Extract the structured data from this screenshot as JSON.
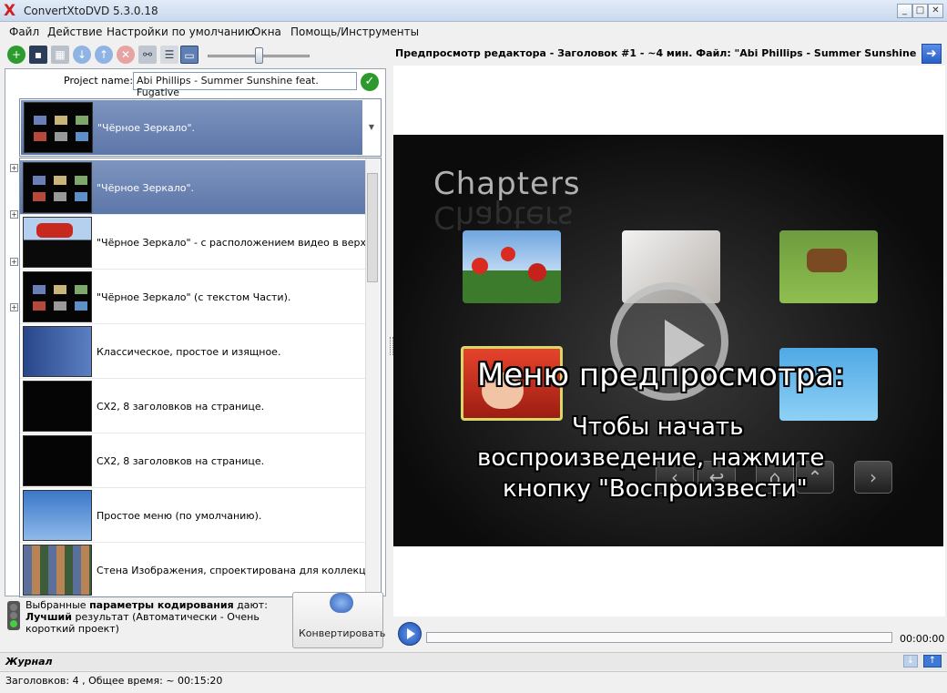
{
  "window": {
    "title": "ConvertXtoDVD 5.3.0.18",
    "app_icon": "X",
    "minimize": "_",
    "maximize": "□",
    "close": "✕"
  },
  "menu": [
    "Файл",
    "Действие",
    "Настройки по умолчанию",
    "Окна",
    "Помощь/Инструменты"
  ],
  "toolbar_icons": [
    "add-icon",
    "save-icon",
    "split-icon",
    "down-icon",
    "up-icon",
    "remove-icon",
    "link-icon",
    "list-icon",
    "monitor-icon"
  ],
  "project": {
    "label": "Project name:",
    "value": "Abi Phillips - Summer Sunshine feat. Fugative"
  },
  "menu_template": {
    "selected": "\"Чёрное Зеркало\".",
    "options": [
      "\"Чёрное Зеркало\".",
      "\"Чёрное Зеркало\" - с расположением видео в верхней трети",
      "\"Чёрное Зеркало\" (с текстом Части).",
      "Классическое, простое и изящное.",
      "CX2, 8 заголовков на странице.",
      "CX2, 8 заголовков на странице.",
      "Простое меню (по умолчанию).",
      "Стена Изображения, спроектирована для коллекции видео"
    ]
  },
  "encoding": {
    "prefix": "Выбранные ",
    "bold": "параметры кодирования",
    "suffix": " дают:",
    "result_bold": "Лучший",
    "result_rest": " результат (Автоматически - Очень короткий проект)"
  },
  "convert_label": "Конвертировать",
  "preview": {
    "header": "Предпросмотр редактора - Заголовок #1 - ~4 мин. Файл: \"Abi Phillips - Summer Sunshine feat. Fuga",
    "stage_title": "Chapters",
    "overlay_line1": "Меню предпросмотра:",
    "overlay_line2": "Чтобы начать",
    "overlay_line3": "воспроизведение, нажмите",
    "overlay_line4": "кнопку \"Воспроизвести\"",
    "time": "00:00:00"
  },
  "journal": "Журнал",
  "status": "Заголовков: 4 , Общее время: ~ 00:15:20",
  "colors": {
    "selection": "#6a82b4",
    "accent_green": "#2e9a2e",
    "stage_bg": "#111111"
  }
}
